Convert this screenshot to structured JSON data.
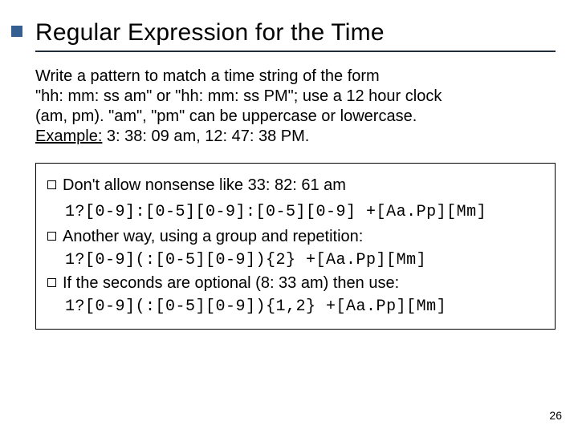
{
  "title": "Regular Expression for the Time",
  "intro": {
    "line1": "Write a pattern to match a time string of the form",
    "line2": "\"hh: mm: ss am\" or \"hh: mm: ss PM\";  use a 12 hour clock",
    "line3": "(am, pm). \"am\", \"pm\" can be uppercase or lowercase.",
    "example_label": "Example:",
    "example_text": " 3: 38: 09 am, 12: 47: 38 PM."
  },
  "bullets": {
    "b1": "Don't allow nonsense like 33: 82: 61 am",
    "b2": "Another way, using a group and repetition:",
    "b3": "If the seconds are optional (8: 33 am) then use:"
  },
  "code": {
    "c1": "1?[0-9]:[0-5][0-9]:[0-5][0-9] +[Aa.Pp][Mm]",
    "c2": "1?[0-9](:[0-5][0-9]){2} +[Aa.Pp][Mm]",
    "c3": "1?[0-9](:[0-5][0-9]){1,2} +[Aa.Pp][Mm]"
  },
  "page_number": "26"
}
